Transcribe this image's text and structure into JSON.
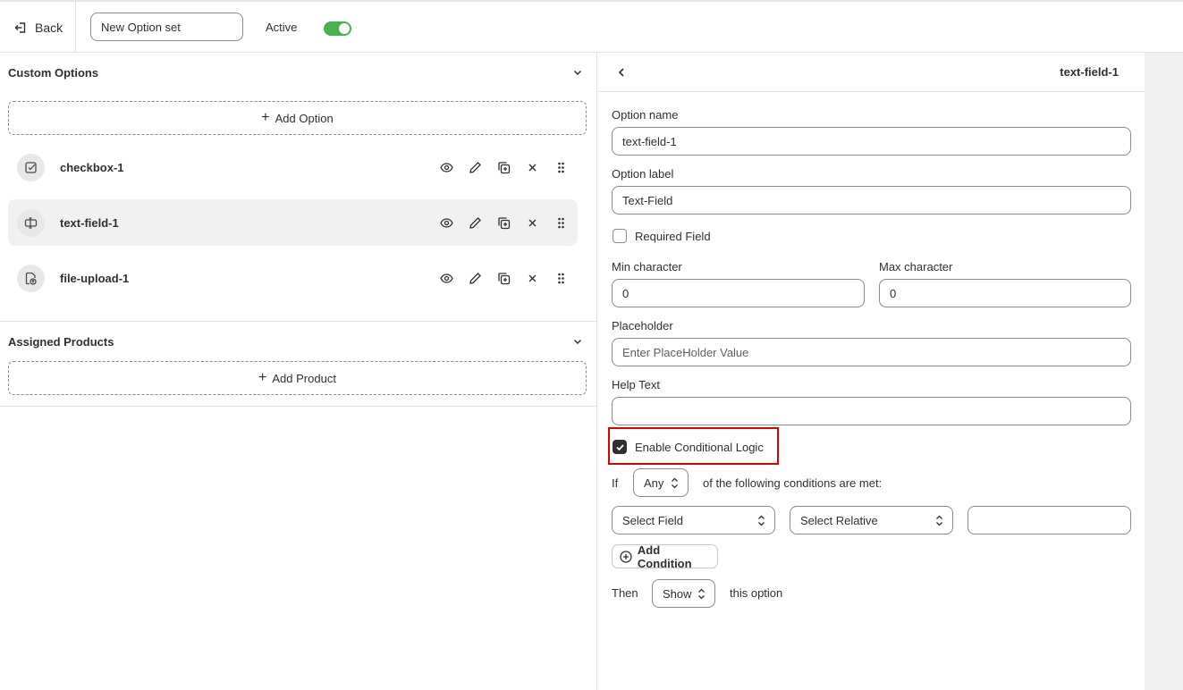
{
  "topbar": {
    "back_label": "Back",
    "option_set_name": "New Option set",
    "active_label": "Active",
    "active": true
  },
  "custom_options": {
    "title": "Custom Options",
    "add_option_label": "Add Option",
    "items": [
      {
        "name": "checkbox-1",
        "icon": "checkbox-icon",
        "selected": false
      },
      {
        "name": "text-field-1",
        "icon": "text-field-icon",
        "selected": true
      },
      {
        "name": "file-upload-1",
        "icon": "file-upload-icon",
        "selected": false
      }
    ],
    "actions": [
      "view-icon",
      "edit-icon",
      "duplicate-icon",
      "delete-icon",
      "drag-handle-icon"
    ]
  },
  "assigned_products": {
    "title": "Assigned Products",
    "add_product_label": "Add Product"
  },
  "editor": {
    "title": "text-field-1",
    "option_name_label": "Option name",
    "option_name_value": "text-field-1",
    "option_label_label": "Option label",
    "option_label_value": "Text-Field",
    "required_label": "Required Field",
    "required": false,
    "min_char_label": "Min character",
    "min_char_value": "0",
    "max_char_label": "Max character",
    "max_char_value": "0",
    "placeholder_label": "Placeholder",
    "placeholder_placeholder": "Enter PlaceHolder Value",
    "help_text_label": "Help Text",
    "help_text_value": "",
    "conditional_label": "Enable Conditional Logic",
    "conditional_enabled": true,
    "if_label": "If",
    "match_value": "Any",
    "conditions_text": "of the following conditions are met:",
    "select_field": "Select Field",
    "select_relative": "Select Relative",
    "condition_value": "",
    "add_condition_label": "Add Condition",
    "then_label": "Then",
    "then_value": "Show",
    "this_option_text": "this option"
  },
  "colors": {
    "toggle_on": "#4caf50",
    "highlight": "#e00000",
    "checkbox_checked": "#303030"
  }
}
